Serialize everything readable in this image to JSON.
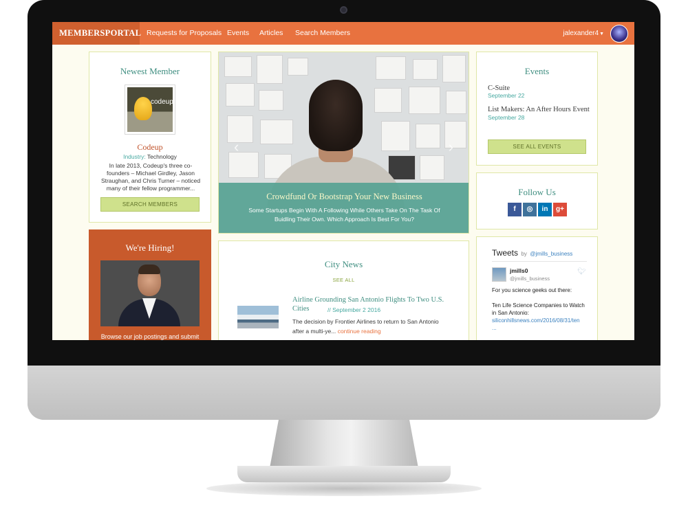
{
  "nav": {
    "brand": "MEMBERSPORTAL",
    "links": [
      "Requests for Proposals",
      "Events",
      "Articles",
      "Search Members"
    ],
    "user": "jalexander4"
  },
  "newest": {
    "title": "Newest Member",
    "logo_text": "codeup",
    "name": "Codeup",
    "industry_label": "Industry:",
    "industry_value": "Technology",
    "desc": "In late 2013, Codeup's three co-founders – Michael Girdley, Jason Straughan, and Chris Turner – noticed many of their fellow programmer...",
    "button": "SEARCH MEMBERS"
  },
  "hiring": {
    "title": "We're Hiring!",
    "text": "Browse our job postings and submit"
  },
  "hero": {
    "title": "Crowdfund Or Bootstrap Your New Business",
    "subtitle": "Some Startups Begin With A Following While Others Take On The Task Of Buidling Their Own. Which Approach Is Best For You?",
    "prev": "‹",
    "next": "›"
  },
  "news": {
    "title": "City News",
    "see_all": "SEE ALL",
    "item_title": "Airline Grounding San Antonio Flights To Two U.S. Cities",
    "item_sep": "//",
    "item_date": "September 2 2016",
    "item_text": "The decision by Frontier Airlines to return to San Antonio after a multi-ye...",
    "item_link": "continue reading"
  },
  "events": {
    "title": "Events",
    "items": [
      {
        "name": "C-Suite",
        "date": "September 22"
      },
      {
        "name": "List Makers: An After Hours Event",
        "date": "September 28"
      }
    ],
    "button": "SEE ALL EVENTS"
  },
  "follow": {
    "title": "Follow Us",
    "icons": [
      "facebook-icon",
      "instagram-icon",
      "linkedin-icon",
      "googleplus-icon"
    ],
    "glyphs": [
      "f",
      "◎",
      "in",
      "g+"
    ],
    "colors": [
      "#3b5998",
      "#3f729b",
      "#0077b5",
      "#dd4b39"
    ]
  },
  "tweets": {
    "title": "Tweets",
    "by": "by",
    "handle": "@jmills_business",
    "author": "jmills0",
    "author_handle": "@jmills_business",
    "line1": "For you science geeks out there:",
    "line2": "Ten Life Science Companies to Watch in San Antonio:",
    "link": "siliconhillsnews.com/2016/08/31/ten",
    "ellipsis": "..."
  }
}
